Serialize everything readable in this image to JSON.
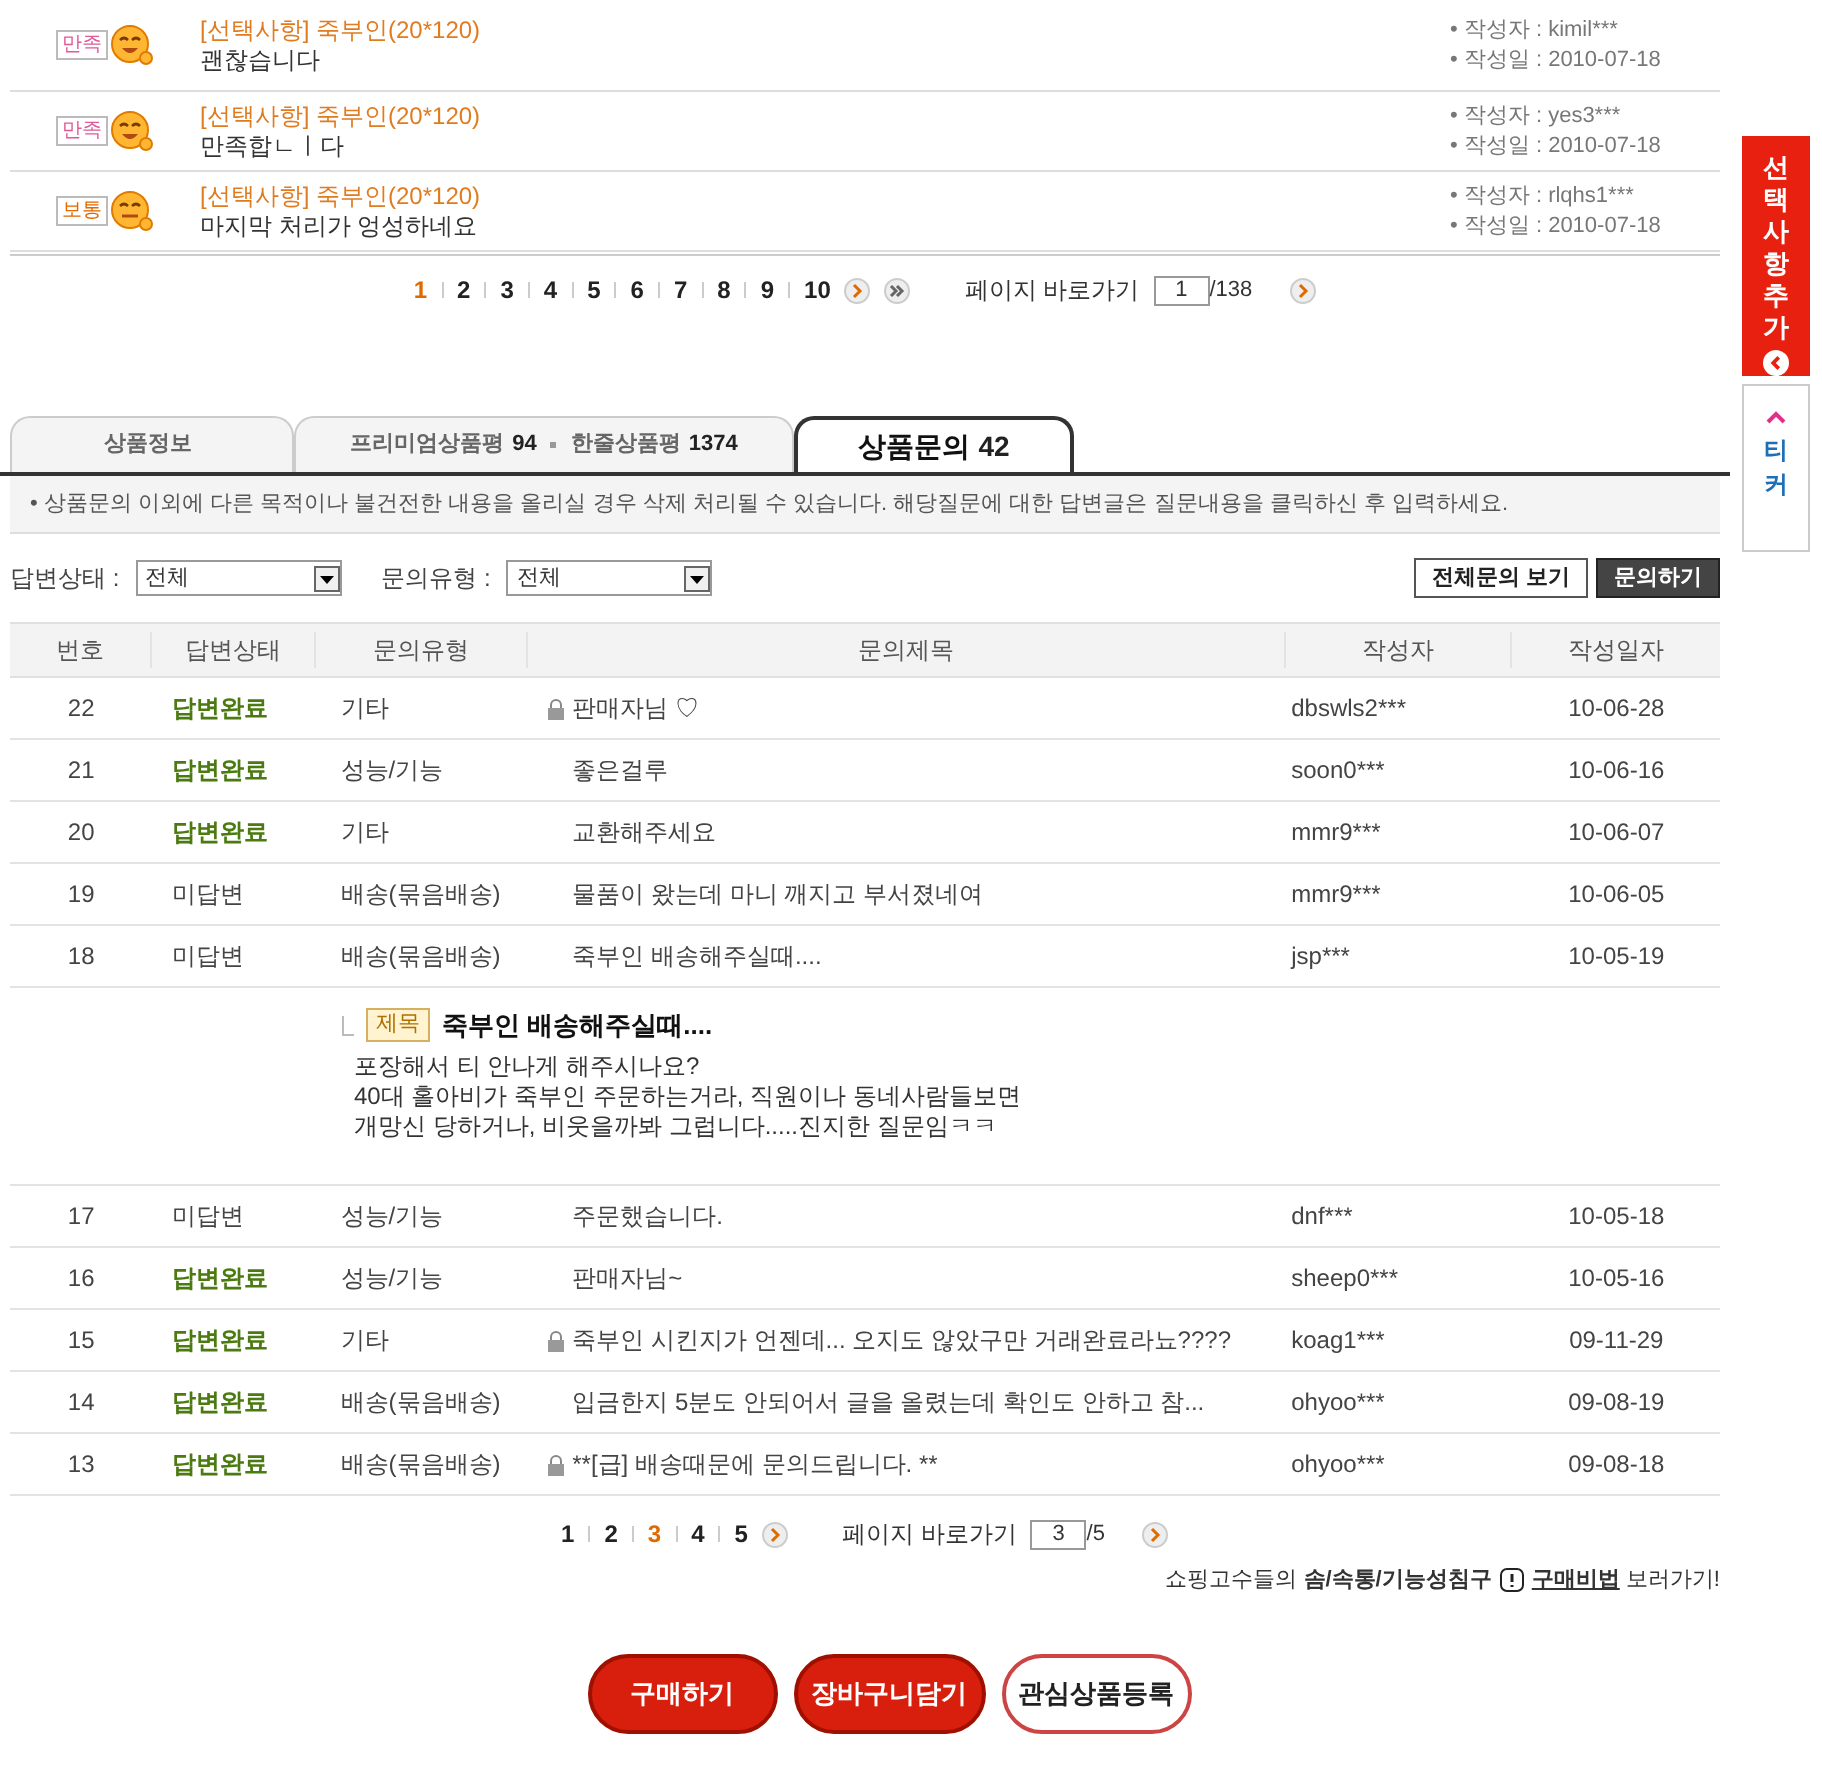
{
  "reviews": [
    {
      "badge": "만족",
      "kind": "happy",
      "option": "[선택사항] 죽부인(20*120)",
      "text": "괜찮습니다",
      "author": "• 작성자 : kimil***",
      "date": "• 작성일 : 2010-07-18"
    },
    {
      "badge": "만족",
      "kind": "happy",
      "option": "[선택사항] 죽부인(20*120)",
      "text": "만족합ㄴㅣ다",
      "author": "• 작성자 : yes3***",
      "date": "• 작성일 : 2010-07-18"
    },
    {
      "badge": "보통",
      "kind": "neutral",
      "option": "[선택사항] 죽부인(20*120)",
      "text": "마지막 처리가 엉성하네요",
      "author": "• 작성자 : rlqhs1***",
      "date": "• 작성일 : 2010-07-18"
    }
  ],
  "review_pagination": {
    "pages": [
      {
        "label": "1",
        "selected": true
      },
      {
        "label": "2",
        "selected": false
      },
      {
        "label": "3",
        "selected": false
      },
      {
        "label": "4",
        "selected": false
      },
      {
        "label": "5",
        "selected": false
      },
      {
        "label": "6",
        "selected": false
      },
      {
        "label": "7",
        "selected": false
      },
      {
        "label": "8",
        "selected": false
      },
      {
        "label": "9",
        "selected": false
      },
      {
        "label": "10",
        "selected": false
      }
    ],
    "jump_label": "페이지 바로가기",
    "jump_value": "1",
    "total": "/138",
    "has_last": true
  },
  "side_tabs": [
    {
      "kind": "red",
      "label": "선택사항추가"
    },
    {
      "kind": "white",
      "label": "티커"
    }
  ],
  "tabs": [
    {
      "label": "상품정보",
      "selected": false
    },
    {
      "label": "프리미엄상품평",
      "count": "94",
      "label2": "한줄상품평",
      "count2": "1374",
      "selected": false
    },
    {
      "label": "상품문의",
      "count": "42",
      "selected": true
    }
  ],
  "notice": "• 상품문의 이외에 다른 목적이나 불건전한 내용을 올리실 경우 삭제 처리될 수 있습니다. 해당질문에 대한 답변글은 질문내용을 클릭하신 후 입력하세요.",
  "filters": [
    {
      "label": "답변상태 :",
      "value": "전체"
    },
    {
      "label": "문의유형 :",
      "value": "전체"
    }
  ],
  "actions": [
    {
      "label": "전체문의 보기",
      "kind": "outline"
    },
    {
      "label": "문의하기",
      "kind": "dark"
    }
  ],
  "table": {
    "columns": [
      "번호",
      "답변상태",
      "문의유형",
      "문의제목",
      "작성자",
      "작성일자"
    ],
    "rows": [
      {
        "no": "22",
        "status": "답변완료",
        "answered": true,
        "type": "기타",
        "locked": true,
        "title": "판매자님 ♡",
        "author": "dbswls2***",
        "date": "10-06-28"
      },
      {
        "no": "21",
        "status": "답변완료",
        "answered": true,
        "type": "성능/기능",
        "locked": false,
        "title": "좋은걸루",
        "author": "soon0***",
        "date": "10-06-16"
      },
      {
        "no": "20",
        "status": "답변완료",
        "answered": true,
        "type": "기타",
        "locked": false,
        "title": "교환해주세요",
        "author": "mmr9***",
        "date": "10-06-07"
      },
      {
        "no": "19",
        "status": "미답변",
        "answered": false,
        "type": "배송(묶음배송)",
        "locked": false,
        "title": "물품이 왔는데 마니 깨지고 부서졌네여",
        "author": "mmr9***",
        "date": "10-06-05"
      },
      {
        "no": "18",
        "status": "미답변",
        "answered": false,
        "type": "배송(묶음배송)",
        "locked": false,
        "title": "죽부인 배송해주실때....",
        "author": "jsp***",
        "date": "10-05-19",
        "detail": {
          "tag": "제목",
          "title": "죽부인 배송해주실때....",
          "lines": [
            "포장해서 티 안나게 해주시나요?",
            "40대 홀아비가 죽부인 주문하는거라, 직원이나 동네사람들보면",
            "개망신 당하거나, 비웃을까봐 그럽니다.....진지한 질문임ㅋㅋ"
          ]
        }
      },
      {
        "no": "17",
        "status": "미답변",
        "answered": false,
        "type": "성능/기능",
        "locked": false,
        "title": "주문했습니다.",
        "author": "dnf***",
        "date": "10-05-18"
      },
      {
        "no": "16",
        "status": "답변완료",
        "answered": true,
        "type": "성능/기능",
        "locked": false,
        "title": "판매자님~",
        "author": "sheep0***",
        "date": "10-05-16"
      },
      {
        "no": "15",
        "status": "답변완료",
        "answered": true,
        "type": "기타",
        "locked": true,
        "title": "죽부인 시킨지가 언젠데... 오지도 않았구만 거래완료라뇨????",
        "author": "koag1***",
        "date": "09-11-29"
      },
      {
        "no": "14",
        "status": "답변완료",
        "answered": true,
        "type": "배송(묶음배송)",
        "locked": false,
        "title": "입금한지 5분도 안되어서 글을 올렸는데 확인도 안하고 참...",
        "author": "ohyoo***",
        "date": "09-08-19"
      },
      {
        "no": "13",
        "status": "답변완료",
        "answered": true,
        "type": "배송(묶음배송)",
        "locked": true,
        "title": "**[급] 배송때문에 문의드립니다. **",
        "author": "ohyoo***",
        "date": "09-08-18"
      }
    ]
  },
  "qna_pagination": {
    "pages": [
      {
        "label": "1",
        "selected": false
      },
      {
        "label": "2",
        "selected": false
      },
      {
        "label": "3",
        "selected": true
      },
      {
        "label": "4",
        "selected": false
      },
      {
        "label": "5",
        "selected": false
      }
    ],
    "jump_label": "페이지 바로가기",
    "jump_value": "3",
    "total": "/5",
    "has_last": false
  },
  "tip": {
    "prefix": "쇼핑고수들의 ",
    "bold": "솜/속통/기능성침구",
    "link": "구매비법",
    "suffix": " 보러가기!"
  },
  "buttons": [
    {
      "label": "구매하기",
      "kind": "red"
    },
    {
      "label": "장바구니담기",
      "kind": "red"
    },
    {
      "label": "관심상품등록",
      "kind": "white"
    }
  ]
}
